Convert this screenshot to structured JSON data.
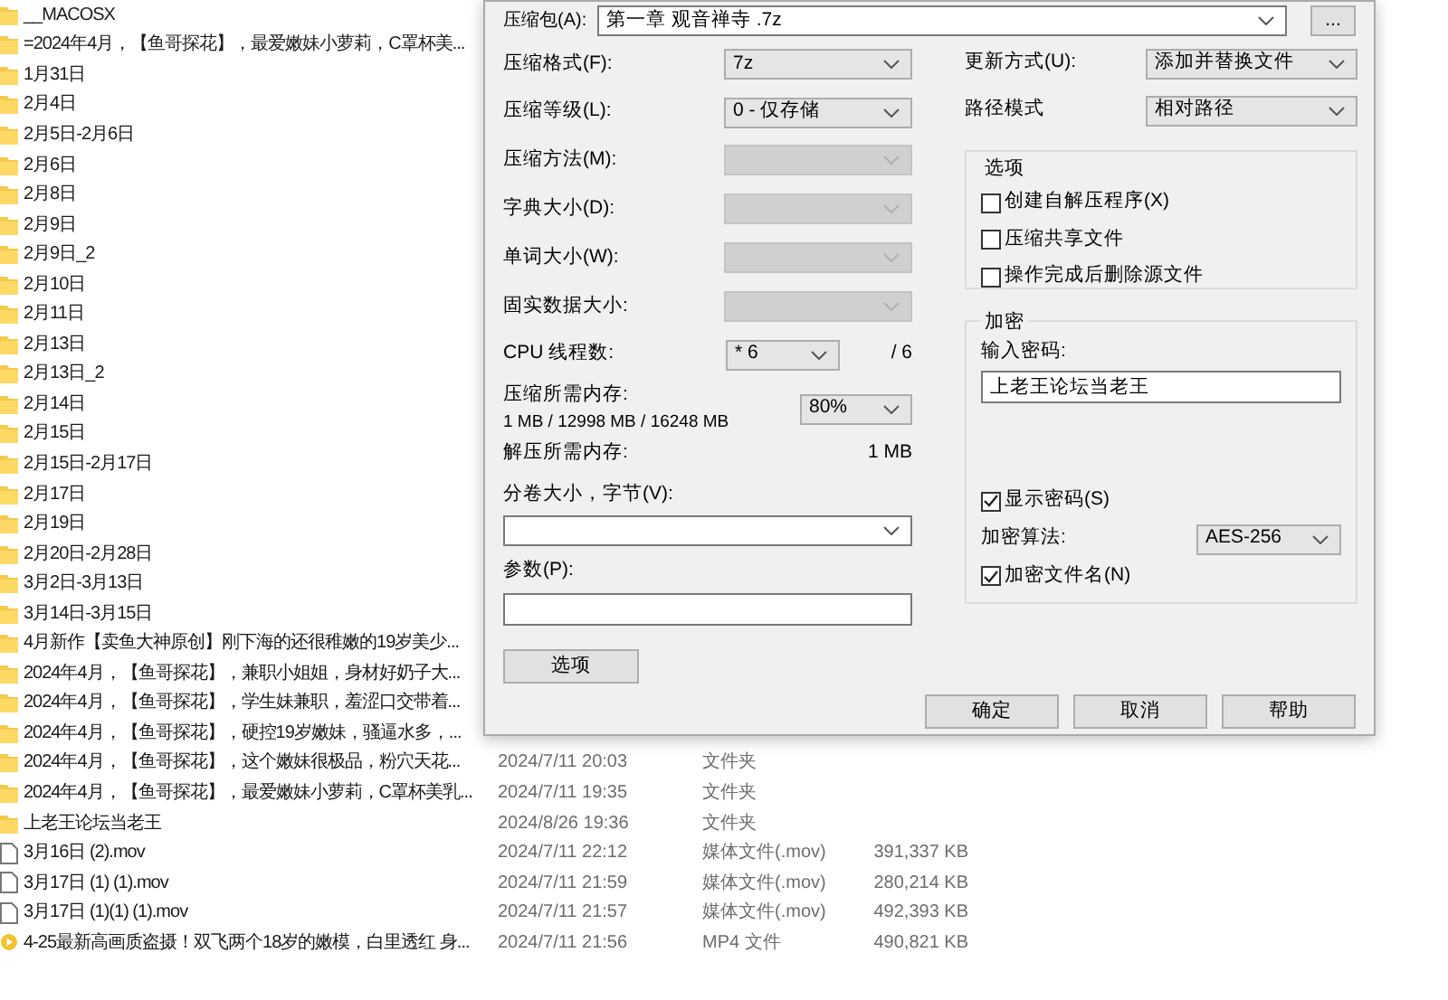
{
  "file_list": {
    "rows": [
      {
        "kind": "folder",
        "name": "__MACOSX"
      },
      {
        "kind": "folder",
        "name": "=2024年4月，【鱼哥探花】，最爱嫩妹小萝莉，C罩杯美..."
      },
      {
        "kind": "folder",
        "name": "1月31日"
      },
      {
        "kind": "folder",
        "name": "2月4日"
      },
      {
        "kind": "folder",
        "name": "2月5日-2月6日"
      },
      {
        "kind": "folder",
        "name": "2月6日"
      },
      {
        "kind": "folder",
        "name": "2月8日"
      },
      {
        "kind": "folder",
        "name": "2月9日"
      },
      {
        "kind": "folder",
        "name": "2月9日_2"
      },
      {
        "kind": "folder",
        "name": "2月10日"
      },
      {
        "kind": "folder",
        "name": "2月11日"
      },
      {
        "kind": "folder",
        "name": "2月13日"
      },
      {
        "kind": "folder",
        "name": "2月13日_2"
      },
      {
        "kind": "folder",
        "name": "2月14日"
      },
      {
        "kind": "folder",
        "name": "2月15日"
      },
      {
        "kind": "folder",
        "name": "2月15日-2月17日"
      },
      {
        "kind": "folder",
        "name": "2月17日"
      },
      {
        "kind": "folder",
        "name": "2月19日"
      },
      {
        "kind": "folder",
        "name": "2月20日-2月28日"
      },
      {
        "kind": "folder",
        "name": "3月2日-3月13日"
      },
      {
        "kind": "folder",
        "name": "3月14日-3月15日"
      },
      {
        "kind": "folder",
        "name": "4月新作【卖鱼大神原创】刚下海的还很稚嫩的19岁美少..."
      },
      {
        "kind": "folder",
        "name": "2024年4月，【鱼哥探花】，兼职小姐姐，身材好奶子大..."
      },
      {
        "kind": "folder",
        "name": "2024年4月，【鱼哥探花】，学生妹兼职，羞涩口交带着..."
      },
      {
        "kind": "folder",
        "name": "2024年4月，【鱼哥探花】，硬控19岁嫩妹，骚逼水多，..."
      },
      {
        "kind": "folder",
        "name": "2024年4月，【鱼哥探花】，这个嫩妹很极品，粉穴天花...",
        "modified": "2024/7/11 20:03",
        "type": "文件夹"
      },
      {
        "kind": "folder",
        "name": "2024年4月，【鱼哥探花】，最爱嫩妹小萝莉，C罩杯美乳...",
        "modified": "2024/7/11 19:35",
        "type": "文件夹"
      },
      {
        "kind": "folder",
        "name": "上老王论坛当老王",
        "modified": "2024/8/26 19:36",
        "type": "文件夹"
      },
      {
        "kind": "file",
        "name": "3月16日 (2).mov",
        "modified": "2024/7/11 22:12",
        "type": "媒体文件(.mov)",
        "size": "391,337 KB"
      },
      {
        "kind": "file",
        "name": "3月17日 (1) (1).mov",
        "modified": "2024/7/11 21:59",
        "type": "媒体文件(.mov)",
        "size": "280,214 KB"
      },
      {
        "kind": "file",
        "name": "3月17日 (1)(1) (1).mov",
        "modified": "2024/7/11 21:57",
        "type": "媒体文件(.mov)",
        "size": "492,393 KB"
      },
      {
        "kind": "video",
        "name": "4-25最新高画质盗摄！双飞两个18岁的嫩模，白里透红 身...",
        "modified": "2024/7/11 21:56",
        "type": "MP4 文件",
        "size": "490,821 KB"
      }
    ]
  },
  "dialog": {
    "archive": {
      "label": "压缩包(A):",
      "value": "第一章 观音禅寺 .7z",
      "browse": "..."
    },
    "left_fields": [
      {
        "kind": "combo",
        "label": "压缩格式(F):",
        "value": "7z",
        "disabled": false
      },
      {
        "kind": "combo",
        "label": "压缩等级(L):",
        "value": "0 - 仅存储",
        "disabled": false
      },
      {
        "kind": "combo",
        "label": "压缩方法(M):",
        "disabled": true
      },
      {
        "kind": "combo",
        "label": "字典大小(D):",
        "disabled": true
      },
      {
        "kind": "combo",
        "label": "单词大小(W):",
        "disabled": true
      },
      {
        "kind": "combo",
        "label": "固实数据大小:",
        "disabled": true
      },
      {
        "kind": "threads",
        "label": "CPU 线程数:",
        "value": "* 6",
        "suffix": "/ 6",
        "disabled": false
      },
      {
        "kind": "memory",
        "label": "压缩所需内存:",
        "detail": "1 MB / 12998 MB / 16248 MB",
        "value": "80%",
        "disabled": false
      },
      {
        "kind": "info",
        "label": "解压所需内存:",
        "value": "1 MB"
      },
      {
        "kind": "wide_combo",
        "label": "分卷大小，字节(V):",
        "disabled": false
      },
      {
        "kind": "text",
        "label": "参数(P):",
        "disabled": false
      }
    ],
    "options_button": "选项",
    "right_fields": [
      {
        "label": "更新方式(U):",
        "value": "添加并替换文件"
      },
      {
        "label": "路径模式",
        "value": "相对路径"
      }
    ],
    "options_group": {
      "title": "选项",
      "checkboxes": [
        {
          "label": "创建自解压程序(X)",
          "checked": false
        },
        {
          "label": "压缩共享文件",
          "checked": false
        },
        {
          "label": "操作完成后删除源文件",
          "checked": false
        }
      ]
    },
    "encryption_group": {
      "title": "加密",
      "password_label": "输入密码:",
      "password": "上老王论坛当老王",
      "show_password": {
        "label": "显示密码(S)",
        "checked": true
      },
      "method_label": "加密算法:",
      "method": "AES-256",
      "encrypt_names": {
        "label": "加密文件名(N)",
        "checked": true
      }
    },
    "buttons": [
      "确定",
      "取消",
      "帮助"
    ]
  }
}
